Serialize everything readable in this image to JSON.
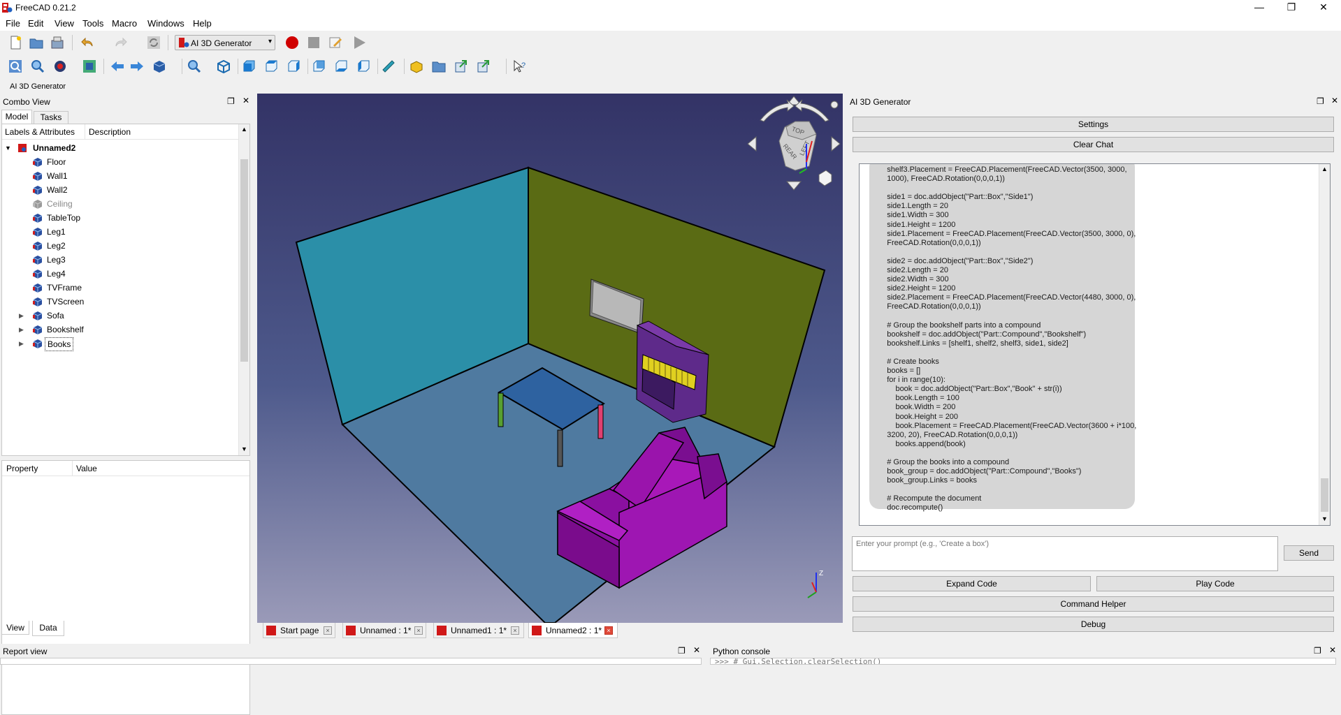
{
  "window": {
    "title": "FreeCAD 0.21.2",
    "minimize": "—",
    "maximize": "❐",
    "close": "✕"
  },
  "menu": [
    "File",
    "Edit",
    "View",
    "Tools",
    "Macro",
    "Windows",
    "Help"
  ],
  "workbench": {
    "selected": "AI 3D Generator"
  },
  "toolbar_label": "AI 3D Generator",
  "combo_view": {
    "title": "Combo View",
    "tabs": [
      "Model",
      "Tasks"
    ],
    "columns": [
      "Labels & Attributes",
      "Description"
    ],
    "root": "Unnamed2",
    "items": [
      "Floor",
      "Wall1",
      "Wall2",
      "Ceiling",
      "TableTop",
      "Leg1",
      "Leg2",
      "Leg3",
      "Leg4",
      "TVFrame",
      "TVScreen",
      "Sofa",
      "Bookshelf",
      "Books"
    ],
    "property_columns": [
      "Property",
      "Value"
    ],
    "bottom_tabs": [
      "View",
      "Data"
    ]
  },
  "doc_tabs": [
    "Start page",
    "Unnamed : 1*",
    "Unnamed1 : 1*",
    "Unnamed2 : 1*"
  ],
  "ai_panel": {
    "title": "AI 3D Generator",
    "settings": "Settings",
    "clear_chat": "Clear Chat",
    "code": "    shelf3.Placement = FreeCAD.Placement(FreeCAD.Vector(3500, 3000,\n    1000), FreeCAD.Rotation(0,0,0,1))\n\n    side1 = doc.addObject(\"Part::Box\",\"Side1\")\n    side1.Length = 20\n    side1.Width = 300\n    side1.Height = 1200\n    side1.Placement = FreeCAD.Placement(FreeCAD.Vector(3500, 3000, 0),\n    FreeCAD.Rotation(0,0,0,1))\n\n    side2 = doc.addObject(\"Part::Box\",\"Side2\")\n    side2.Length = 20\n    side2.Width = 300\n    side2.Height = 1200\n    side2.Placement = FreeCAD.Placement(FreeCAD.Vector(4480, 3000, 0),\n    FreeCAD.Rotation(0,0,0,1))\n\n    # Group the bookshelf parts into a compound\n    bookshelf = doc.addObject(\"Part::Compound\",\"Bookshelf\")\n    bookshelf.Links = [shelf1, shelf2, shelf3, side1, side2]\n\n    # Create books\n    books = []\n    for i in range(10):\n        book = doc.addObject(\"Part::Box\",\"Book\" + str(i))\n        book.Length = 100\n        book.Width = 200\n        book.Height = 200\n        book.Placement = FreeCAD.Placement(FreeCAD.Vector(3600 + i*100,\n    3200, 20), FreeCAD.Rotation(0,0,0,1))\n        books.append(book)\n\n    # Group the books into a compound\n    book_group = doc.addObject(\"Part::Compound\",\"Books\")\n    book_group.Links = books\n\n    # Recompute the document\n    doc.recompute()",
    "prompt_placeholder": "Enter your prompt (e.g., 'Create a box')",
    "send": "Send",
    "expand_code": "Expand Code",
    "play_code": "Play Code",
    "command_helper": "Command Helper",
    "debug": "Debug"
  },
  "report_view": {
    "title": "Report view"
  },
  "python_console": {
    "title": "Python console",
    "line": ">>> # Gui.Selection.clearSelection()"
  },
  "navcube": {
    "top": "TOP",
    "rear": "REAR",
    "left": "LEFT"
  },
  "axes": {
    "z": "Z"
  }
}
